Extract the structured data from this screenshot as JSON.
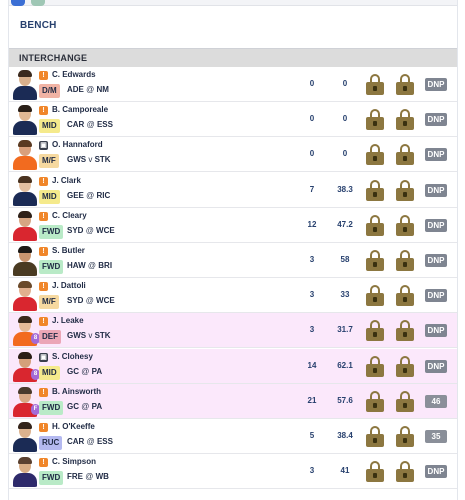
{
  "bench": {
    "title": "BENCH"
  },
  "interchange": {
    "title": "INTERCHANGE"
  },
  "colors": {
    "row_highlight": "#fbe8fb",
    "lock_color": "#8c7740",
    "status_orange": "#f0862a",
    "result_badge": "#7f8591"
  },
  "players": [
    {
      "name": "C. Edwards",
      "position": "D/M",
      "team": "ADE",
      "sep": "@",
      "opponent": "NM",
      "stat1": "0",
      "stat2": "0",
      "result": "DNP",
      "status_icon": "orange-note-icon",
      "highlight": false
    },
    {
      "name": "B. Camporeale",
      "position": "MID",
      "team": "CAR",
      "sep": "@",
      "opponent": "ESS",
      "stat1": "0",
      "stat2": "0",
      "result": "DNP",
      "status_icon": "orange-note-icon",
      "highlight": false
    },
    {
      "name": "O. Hannaford",
      "position": "M/F",
      "team": "GWS",
      "sep": "v",
      "opponent": "STK",
      "stat1": "0",
      "stat2": "0",
      "result": "DNP",
      "status_icon": "camera-icon",
      "highlight": false
    },
    {
      "name": "J. Clark",
      "position": "MID",
      "team": "GEE",
      "sep": "@",
      "opponent": "RIC",
      "stat1": "7",
      "stat2": "38.3",
      "result": "DNP",
      "status_icon": "orange-note-icon",
      "highlight": false
    },
    {
      "name": "C. Cleary",
      "position": "FWD",
      "team": "SYD",
      "sep": "@",
      "opponent": "WCE",
      "stat1": "12",
      "stat2": "47.2",
      "result": "DNP",
      "status_icon": "orange-note-icon",
      "highlight": false
    },
    {
      "name": "S. Butler",
      "position": "FWD",
      "team": "HAW",
      "sep": "@",
      "opponent": "BRI",
      "stat1": "3",
      "stat2": "58",
      "result": "DNP",
      "status_icon": "orange-note-icon",
      "highlight": false
    },
    {
      "name": "J. Dattoli",
      "position": "M/F",
      "team": "SYD",
      "sep": "@",
      "opponent": "WCE",
      "stat1": "3",
      "stat2": "33",
      "result": "DNP",
      "status_icon": "orange-note-icon",
      "highlight": false
    },
    {
      "name": "J. Leake",
      "position": "DEF",
      "team": "GWS",
      "sep": "v",
      "opponent": "STK",
      "stat1": "3",
      "stat2": "31.7",
      "result": "DNP",
      "status_icon": "orange-note-icon",
      "highlight": true,
      "side_badge": "8"
    },
    {
      "name": "S. Clohesy",
      "position": "MID",
      "team": "GC",
      "sep": "@",
      "opponent": "PA",
      "stat1": "14",
      "stat2": "62.1",
      "result": "DNP",
      "status_icon": "camera-icon",
      "highlight": true,
      "side_badge": "8"
    },
    {
      "name": "B. Ainsworth",
      "position": "FWD",
      "team": "GC",
      "sep": "@",
      "opponent": "PA",
      "stat1": "21",
      "stat2": "57.6",
      "result": "46",
      "status_icon": "orange-note-icon",
      "highlight": true,
      "side_badge": "F"
    },
    {
      "name": "H. O'Keeffe",
      "position": "RUC",
      "team": "CAR",
      "sep": "@",
      "opponent": "ESS",
      "stat1": "5",
      "stat2": "38.4",
      "result": "35",
      "status_icon": "orange-note-icon",
      "highlight": false
    },
    {
      "name": "C. Simpson",
      "position": "FWD",
      "team": "FRE",
      "sep": "@",
      "opponent": "WB",
      "stat1": "3",
      "stat2": "41",
      "result": "DNP",
      "status_icon": "orange-note-icon",
      "highlight": false
    }
  ]
}
